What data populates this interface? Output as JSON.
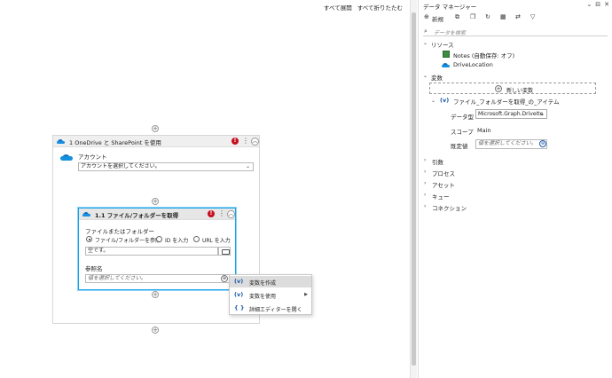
{
  "toolbar": {
    "expand_all": "すべて展開",
    "collapse_all": "すべて折りたたむ"
  },
  "card1": {
    "title": "1  OneDrive と SharePoint を使用",
    "error_badge": "!",
    "account_label": "アカウント",
    "account_value": "アカウントを選択してください。"
  },
  "card2": {
    "title": "1.1  ファイル/フォルダーを取得",
    "error_badge": "!",
    "file_label": "ファイルまたはフォルダー",
    "radio_browse": "ファイル/フォルダーを参照",
    "radio_id": "ID を入力",
    "radio_url": "URL を入力",
    "path_value": "空です。",
    "ref_label": "参照名",
    "ref_placeholder": "値を選択してください。"
  },
  "context_menu": {
    "items": [
      {
        "icon": "(v)",
        "label": "変数を作成"
      },
      {
        "icon": "(v)",
        "label": "変数を使用"
      },
      {
        "icon": "{ }",
        "label": "詳細エディターを開く"
      }
    ]
  },
  "data_manager": {
    "title": "データ マネージャー",
    "new_label": "新規",
    "search_placeholder": "データを検索",
    "resources_label": "リソース",
    "notes_label": "Notes (自動保存: オフ)",
    "drive_label": "DriveLocation",
    "variables_label": "変数",
    "new_variable_label": "新しい変数",
    "variable_name": "ファイル_フォルダーを取得_の_アイテム",
    "data_type_label": "データ型",
    "data_type_value": "Microsoft.Graph.DriveIte",
    "scope_label": "スコープ",
    "scope_value": "Main",
    "default_label": "既定値",
    "default_placeholder": "値を選択してください。",
    "sections": [
      "引数",
      "プロセス",
      "アセット",
      "キュー",
      "コネクション"
    ]
  },
  "colors": {
    "accent": "#1aa3e8",
    "error": "#c50f1f",
    "onedrive": "#0f6cbd"
  }
}
